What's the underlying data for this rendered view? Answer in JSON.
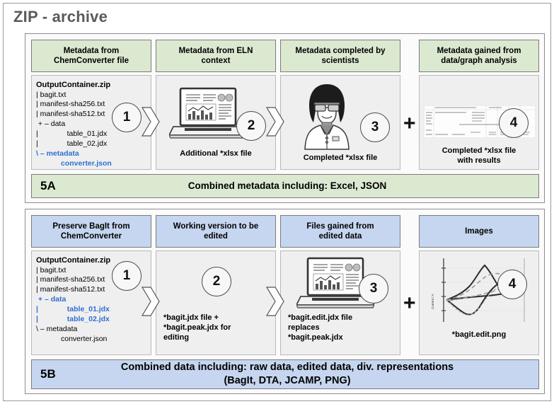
{
  "title": "ZIP - archive",
  "colors": {
    "green": "#dce9d1",
    "blue": "#c6d6f0",
    "panel_bg": "#efefef",
    "tree_blue": "#2f6fd0",
    "title_gray": "#5a5a5a"
  },
  "group_a": {
    "headers": [
      "Metadata from\nChemConverter file",
      "Metadata from ELN\ncontext",
      "Metadata completed by\nscientists",
      "Metadata gained from\ndata/graph analysis"
    ],
    "steps": [
      "1",
      "2",
      "3",
      "4"
    ],
    "tree": {
      "lines": [
        {
          "text": "OutputContainer.zip",
          "style": "bold-black"
        },
        {
          "text": "| bagit.txt",
          "style": "black"
        },
        {
          "text": "| manifest-sha256.txt",
          "style": "black"
        },
        {
          "text": "| manifest-sha512.txt",
          "style": "black"
        },
        {
          "text": " + – data",
          "style": "black"
        },
        {
          "text": "|              table_01.jdx",
          "style": "black"
        },
        {
          "text": "|              table_02.jdx",
          "style": "black"
        },
        {
          "text": "\\ – metadata",
          "style": "blue"
        },
        {
          "text": "            converter.json",
          "style": "blue"
        }
      ]
    },
    "captions": [
      "Additional *xlsx file",
      "Completed *xlsx file",
      "Completed *xlsx file\nwith results"
    ],
    "separator": "+",
    "summary": {
      "code": "5A",
      "text": "Combined metadata including: Excel, JSON"
    },
    "icons": [
      "laptop-chart-icon",
      "scientist-icon",
      "spreadsheet-icon"
    ]
  },
  "group_b": {
    "headers": [
      "Preserve BagIt from\nChemConverter",
      "Working version to be\nedited",
      "Files gained from\nedited data",
      "Images"
    ],
    "steps": [
      "1",
      "2",
      "3",
      "4"
    ],
    "tree": {
      "lines": [
        {
          "text": "OutputContainer.zip",
          "style": "bold-black"
        },
        {
          "text": "| bagit.txt",
          "style": "black"
        },
        {
          "text": "| manifest-sha256.txt",
          "style": "black"
        },
        {
          "text": "| manifest-sha512.txt",
          "style": "black"
        },
        {
          "text": " + – data",
          "style": "blue"
        },
        {
          "text": "|              table_01.jdx",
          "style": "blue"
        },
        {
          "text": "|              table_02.jdx",
          "style": "blue"
        },
        {
          "text": "\\ – metadata",
          "style": "black"
        },
        {
          "text": "            converter.json",
          "style": "black"
        }
      ]
    },
    "captions": [
      "*bagit.jdx file +\n*bagit.peak.jdx for\nediting",
      "*bagit.edit.jdx file\nreplaces\n*bagit.peak.jdx",
      "*bagit.edit.png"
    ],
    "separator": "+",
    "summary": {
      "code": "5B",
      "text": "Combined data including: raw data, edited data, div. representations\n(BagIt, DTA, JCAMP, PNG)"
    },
    "plot": {
      "ylabel": "Current / A",
      "type": "cyclic-voltammogram"
    },
    "icons": [
      "laptop-chart-icon",
      "cv-plot-icon"
    ]
  }
}
